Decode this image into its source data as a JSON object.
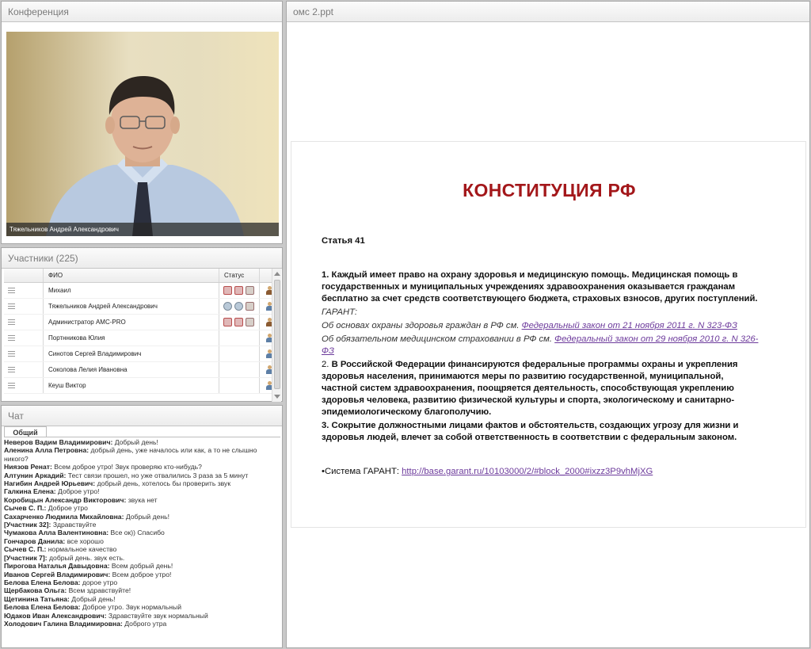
{
  "conference": {
    "title": "Конференция",
    "video_caption": "Тяжельников Андрей Александрович"
  },
  "participants": {
    "title": "Участники (225)",
    "col_name": "ФИО",
    "col_status": "Статус",
    "rows": [
      {
        "name": "Михаил"
      },
      {
        "name": "Тяжельников Андрей Александрович"
      },
      {
        "name": "Администратор АМС-PRO"
      },
      {
        "name": "Портнникова Юлия"
      },
      {
        "name": "Синотов Сергей Владимирович"
      },
      {
        "name": "Соколова Лелия Ивановна"
      },
      {
        "name": "Кеуш Виктор"
      }
    ]
  },
  "chat": {
    "title": "Чат",
    "tab": "Общий",
    "messages": [
      {
        "who": "Неверов Вадим Владимирович:",
        "text": "Добрый день!"
      },
      {
        "who": "Аленина Алла Петровна:",
        "text": "добрый день, уже началось или как, а то не слышно никого?"
      },
      {
        "who": "Ниязов Ренат:",
        "text": "Всем доброе утро! Звук проверяю кто-нибудь?"
      },
      {
        "who": "Алтунин Аркадий:",
        "text": "Тест связи прошел, но уже отвалились 3 раза за 5 минут"
      },
      {
        "who": "Нагибин Андрей Юрьевич:",
        "text": "добрый день, хотелось бы проверить звук"
      },
      {
        "who": "Галкина Елена:",
        "text": "Доброе утро!"
      },
      {
        "who": "Коробицын Александр Викторович:",
        "text": "звука нет"
      },
      {
        "who": "Сычев С. П.:",
        "text": "Доброе утро"
      },
      {
        "who": "Сахарченко Людмила Михайловна:",
        "text": "Добрый день!"
      },
      {
        "who": "[Участник 32]:",
        "text": "Здравствуйте"
      },
      {
        "who": "Чумакова Алла Валентиновна:",
        "text": "Все ок)) Спасибо"
      },
      {
        "who": "Гончаров Данила:",
        "text": "все хорошо"
      },
      {
        "who": "Сычев С. П.:",
        "text": "нормальное качество"
      },
      {
        "who": "[Участник 7]:",
        "text": "добрый день. звук есть."
      },
      {
        "who": "Пирогова Наталья Давыдовна:",
        "text": "Всем добрый день!"
      },
      {
        "who": "Иванов Сергей Владимирович:",
        "text": "Всем доброе утро!"
      },
      {
        "who": "Белова Елена Белова:",
        "text": "дорое утро"
      },
      {
        "who": "Щербакова Ольга:",
        "text": "Всем здравствуйте!"
      },
      {
        "who": "Щетинина Татьяна:",
        "text": "Добрый день!"
      },
      {
        "who": "Белова Елена Белова:",
        "text": "Доброе утро. Звук нормальный"
      },
      {
        "who": "Юдаков Иван Александрович:",
        "text": "Здравствуйте звук нормальный"
      },
      {
        "who": "Холодович Галина Владимировна:",
        "text": "Доброго утра"
      }
    ]
  },
  "slide": {
    "file_title": "омс 2.ppt",
    "heading": "КОНСТИТУЦИЯ РФ",
    "article": "Статья 41",
    "p1": "1. Каждый имеет право на охрану здоровья и медицинскую помощь. Медицинская помощь в государственных и муниципальных учреждениях здравоохранения оказывается гражданам бесплатно за счет средств соответствующего бюджета, страховых взносов, других поступлений.",
    "garant": "ГАРАНТ:",
    "ref1_text": "Об основах охраны здоровья граждан в РФ см.",
    "ref1_link": "Федеральный закон от 21 ноября 2011 г. N 323-ФЗ",
    "ref2_text": "Об обязательном медицинском страховании в РФ см.",
    "ref2_link": "Федеральный закон от 29 ноября 2010 г. N 326-ФЗ",
    "p2_lead": "2.",
    "p2": "В Российской Федерации финансируются федеральные программы охраны и укрепления здоровья населения, принимаются меры по развитию государственной, муниципальной, частной систем здравоохранения, поощряется деятельность, способствующая укреплению здоровья человека, развитию физической культуры и спорта, экологическому и санитарно-эпидемиологическому благополучию.",
    "p3": "3. Сокрытие должностными лицами фактов и обстоятельств, создающих угрозу для жизни и здоровья людей, влечет за собой ответственность в соответствии с федеральным законом.",
    "system_label": "•Система ГАРАНТ:",
    "system_link": "http://base.garant.ru/10103000/2/#block_2000#ixzz3P9vhMjXG"
  },
  "colors": {
    "title_red": "#a3171a",
    "link_purple": "#6d3b9c"
  }
}
